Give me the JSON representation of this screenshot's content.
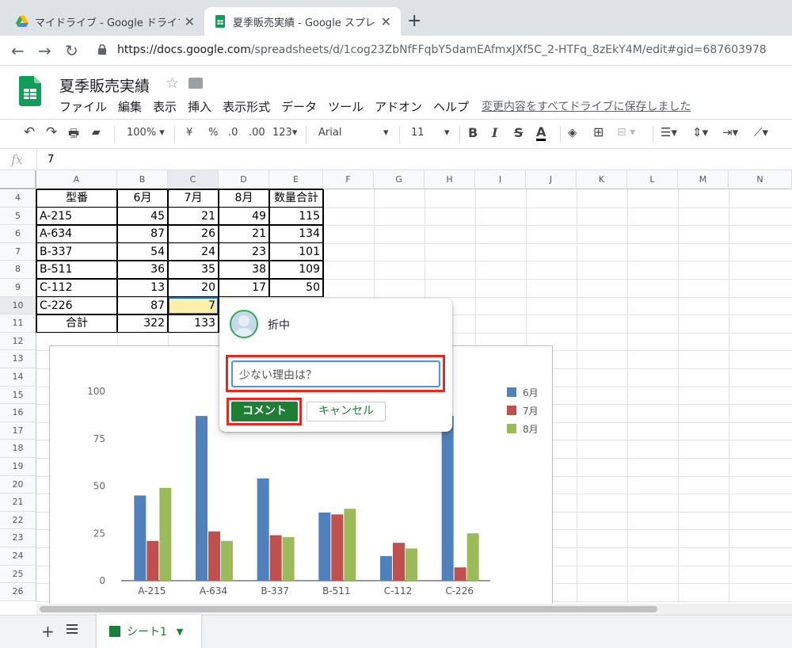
{
  "browser": {
    "tabs": [
      {
        "title": "マイドライブ - Google ドライブ",
        "active": false
      },
      {
        "title": "夏季販売実績 - Google スプレッドシ",
        "active": true
      }
    ],
    "url_host": "https://docs.google.com",
    "url_path": "/spreadsheets/d/1cog23ZbNfFFqbY5damEAfmxJXf5C_2-HTFq_8zEkY4M/edit#gid=687603978"
  },
  "doc": {
    "title": "夏季販売実績",
    "menu": [
      "ファイル",
      "編集",
      "表示",
      "挿入",
      "表示形式",
      "データ",
      "ツール",
      "アドオン",
      "ヘルプ"
    ],
    "saved_status": "変更内容をすべてドライブに保存しました"
  },
  "toolbar": {
    "zoom": "100%",
    "currency": "¥",
    "percent": "%",
    "dec_less": ".0",
    "dec_more": ".00",
    "format_more": "123",
    "font": "Arial",
    "font_size": "11",
    "bold": "B",
    "italic": "I",
    "strike": "S",
    "text_color": "A"
  },
  "formula_bar": {
    "fx": "fx",
    "value": "7"
  },
  "grid": {
    "columns": [
      "A",
      "B",
      "C",
      "D",
      "E",
      "F",
      "G",
      "H",
      "I",
      "J",
      "K",
      "L",
      "M",
      "N"
    ],
    "rows": [
      "4",
      "5",
      "6",
      "7",
      "8",
      "9",
      "10",
      "11",
      "12",
      "13",
      "14",
      "15",
      "16",
      "17",
      "18",
      "19",
      "20",
      "21",
      "22",
      "23",
      "24",
      "25",
      "26"
    ],
    "header": [
      "型番",
      "6月",
      "7月",
      "8月",
      "数量合計"
    ],
    "data": [
      [
        "A-215",
        "45",
        "21",
        "49",
        "115"
      ],
      [
        "A-634",
        "87",
        "26",
        "21",
        "134"
      ],
      [
        "B-337",
        "54",
        "24",
        "23",
        "101"
      ],
      [
        "B-511",
        "36",
        "35",
        "38",
        "109"
      ],
      [
        "C-112",
        "13",
        "20",
        "17",
        "50"
      ],
      [
        "C-226",
        "87",
        "7",
        "",
        ""
      ]
    ],
    "total": [
      "合計",
      "322",
      "133",
      "",
      ""
    ]
  },
  "comment": {
    "user": "折中",
    "text": "少ない理由は？",
    "submit_label": "コメント",
    "cancel_label": "キャンセル"
  },
  "sheets": {
    "active": "シート1"
  },
  "colors": {
    "jun": "#4f81bd",
    "jul": "#c0504d",
    "aug": "#9bbb59",
    "green": "#1e7e34",
    "highlight": "#e52a1f"
  },
  "chart_data": {
    "type": "bar",
    "title": "",
    "xlabel": "",
    "ylabel": "",
    "categories": [
      "A-215",
      "A-634",
      "B-337",
      "B-511",
      "C-112",
      "C-226"
    ],
    "series": [
      {
        "name": "6月",
        "values": [
          45,
          87,
          54,
          36,
          13,
          87
        ]
      },
      {
        "name": "7月",
        "values": [
          21,
          26,
          24,
          35,
          20,
          7
        ]
      },
      {
        "name": "8月",
        "values": [
          49,
          21,
          23,
          38,
          17,
          25
        ]
      }
    ],
    "yticks": [
      "0",
      "25",
      "50",
      "75",
      "100"
    ],
    "ylim": [
      0,
      100
    ],
    "legend": "right",
    "grid": false
  }
}
